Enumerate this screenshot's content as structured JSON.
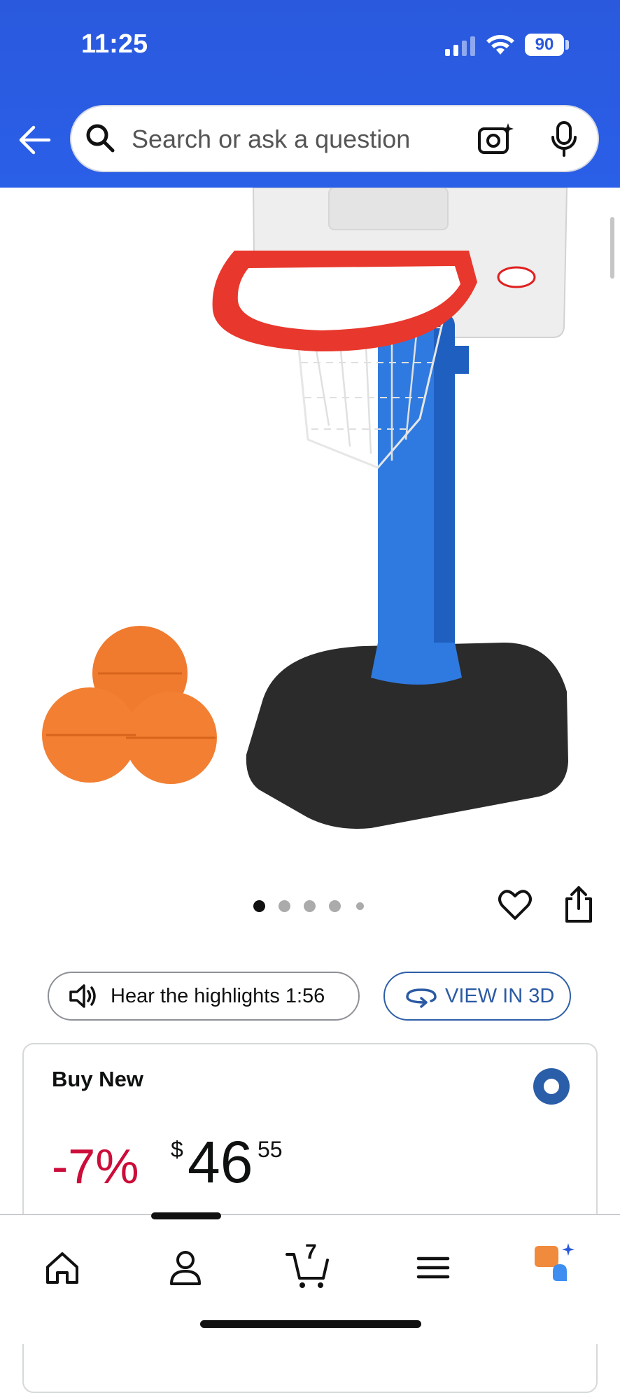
{
  "status_bar": {
    "time": "11:25",
    "battery": "90"
  },
  "search": {
    "placeholder": "Search or ask a question"
  },
  "product": {
    "image_dots": {
      "count": 5,
      "active_index": 0
    },
    "audio_button_label": "Hear the highlights 1:56",
    "view_3d_label": "VIEW IN 3D"
  },
  "buy_box": {
    "title": "Buy New",
    "discount": "-7%",
    "currency": "$",
    "price_whole": "46",
    "price_fraction": "55"
  },
  "bottom_nav": {
    "items": [
      "home-icon",
      "account-icon",
      "cart-icon",
      "menu-icon",
      "rufus-assistant-icon"
    ],
    "cart_count": "7"
  },
  "colors": {
    "header_blue": "#2a59dd",
    "discount_red": "#cc0c39",
    "link_blue": "#2b5aa3",
    "assistant_orange": "#f08a3c",
    "assistant_blue": "#3d8ef0"
  }
}
